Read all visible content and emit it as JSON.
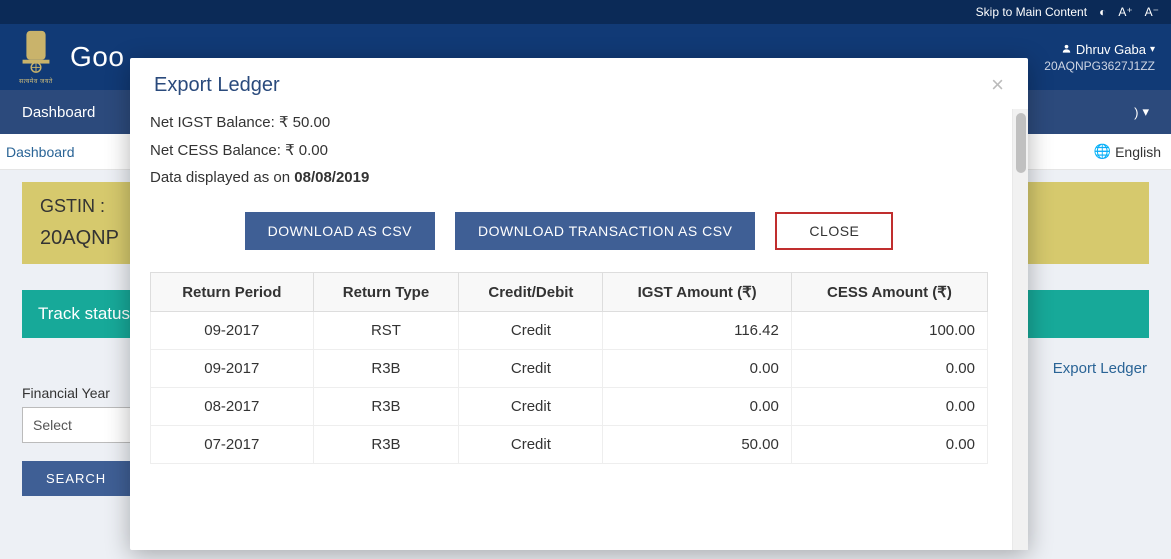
{
  "util": {
    "skip": "Skip to Main Content",
    "contrast": "◐",
    "a_plus": "A⁺",
    "a_minus": "A⁻"
  },
  "header": {
    "brand_text": "Goo",
    "emblem_caption": "सत्यमेव जयते",
    "user_name": "Dhruv Gaba",
    "gstin": "20AQNPG3627J1ZZ"
  },
  "nav": {
    "dashboard": "Dashboard",
    "right_frag": ") "
  },
  "breadcrumb": {
    "dashboard": "Dashboard",
    "language": "English"
  },
  "page": {
    "gstin_label": "GSTIN :",
    "gstin_value": "20AQNP",
    "track_status": "Track status",
    "export_link": "Export Ledger",
    "fy_label": "Financial Year",
    "fy_select": "Select",
    "search": "SEARCH"
  },
  "modal": {
    "title": "Export Ledger",
    "net_igst_label": "Net IGST Balance: ₹ ",
    "net_igst_value": "50.00",
    "net_cess_label": "Net CESS Balance: ₹ ",
    "net_cess_value": "0.00",
    "data_as_on_label": "Data displayed as on ",
    "data_as_on_date": "08/08/2019",
    "btn_csv": "DOWNLOAD AS CSV",
    "btn_txn_csv": "DOWNLOAD TRANSACTION AS CSV",
    "btn_close": "CLOSE",
    "table": {
      "headers": {
        "return_period": "Return Period",
        "return_type": "Return Type",
        "credit_debit": "Credit/Debit",
        "igst_amount": "IGST Amount (₹)",
        "cess_amount": "CESS Amount (₹)"
      },
      "rows": [
        {
          "period": "09-2017",
          "type": "RST",
          "cd": "Credit",
          "igst": "116.42",
          "cess": "100.00"
        },
        {
          "period": "09-2017",
          "type": "R3B",
          "cd": "Credit",
          "igst": "0.00",
          "cess": "0.00"
        },
        {
          "period": "08-2017",
          "type": "R3B",
          "cd": "Credit",
          "igst": "0.00",
          "cess": "0.00"
        },
        {
          "period": "07-2017",
          "type": "R3B",
          "cd": "Credit",
          "igst": "50.00",
          "cess": "0.00"
        }
      ]
    }
  }
}
